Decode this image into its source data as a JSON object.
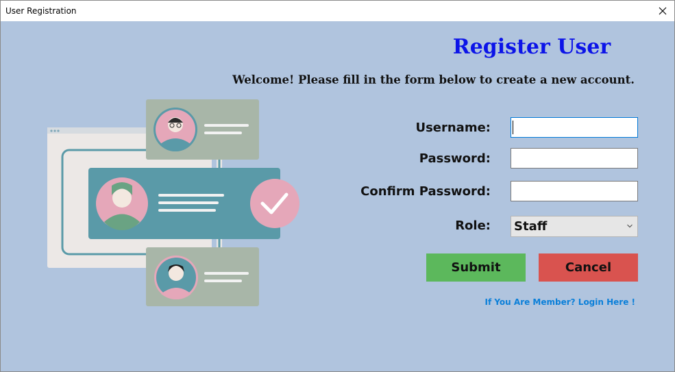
{
  "window": {
    "title": "User Registration"
  },
  "form": {
    "heading": "Register User",
    "subheading": "Welcome! Please fill in the form below to create a new account.",
    "username": {
      "label": "Username:",
      "value": "",
      "placeholder": ""
    },
    "password": {
      "label": "Password:",
      "value": "",
      "placeholder": ""
    },
    "confirm_password": {
      "label": "Confirm Password:",
      "value": "",
      "placeholder": ""
    },
    "role": {
      "label": "Role:",
      "selected": "Staff"
    },
    "submit_label": "Submit",
    "cancel_label": "Cancel",
    "login_link": "If You Are Member? Login Here !"
  },
  "colors": {
    "background": "#b0c4de",
    "heading": "#0c14e8",
    "submit": "#5cb85c",
    "cancel": "#d9534f",
    "link": "#0a7fd9"
  },
  "icons": {
    "close": "close-icon",
    "dropdown": "chevron-down-icon",
    "illustration": "user-profiles-illustration"
  }
}
